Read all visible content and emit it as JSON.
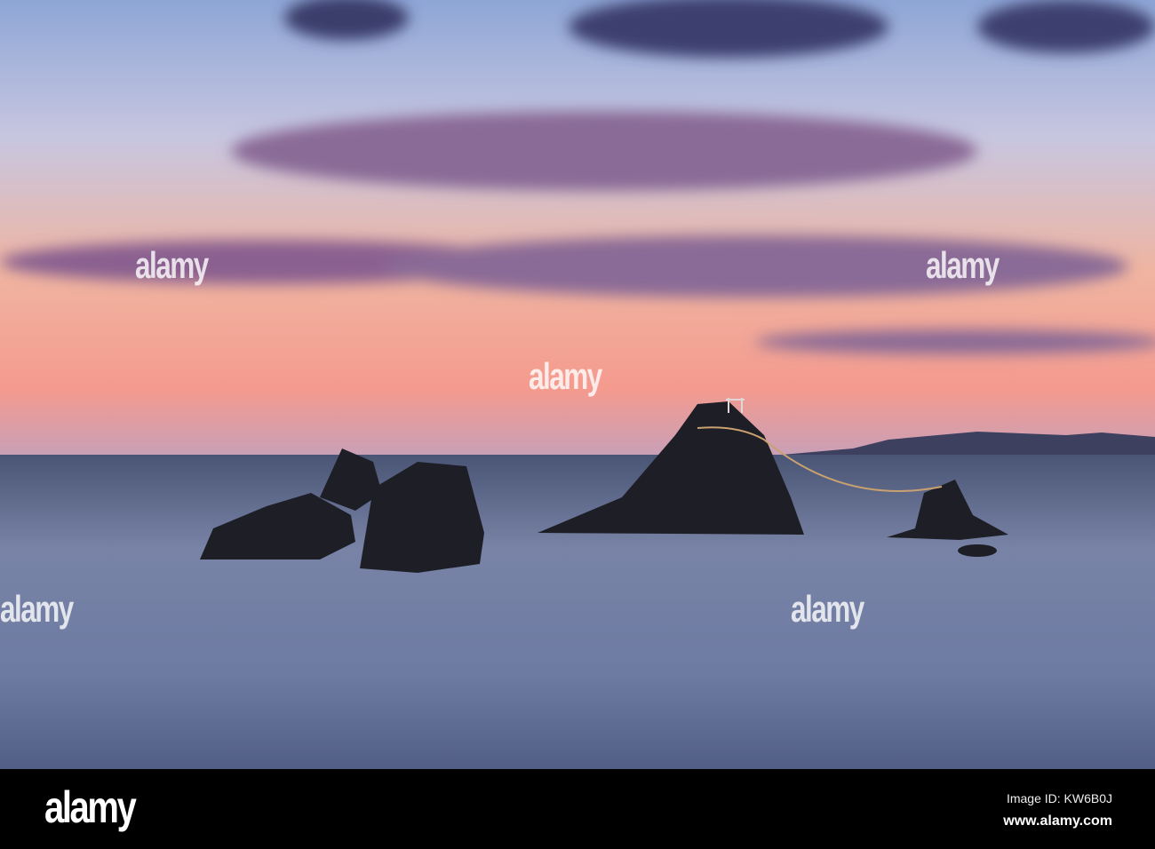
{
  "watermark": {
    "text": "alamy"
  },
  "footer": {
    "logo": "alamy",
    "image_id": "Image ID: KW6B0J",
    "url": "www.alamy.com"
  }
}
